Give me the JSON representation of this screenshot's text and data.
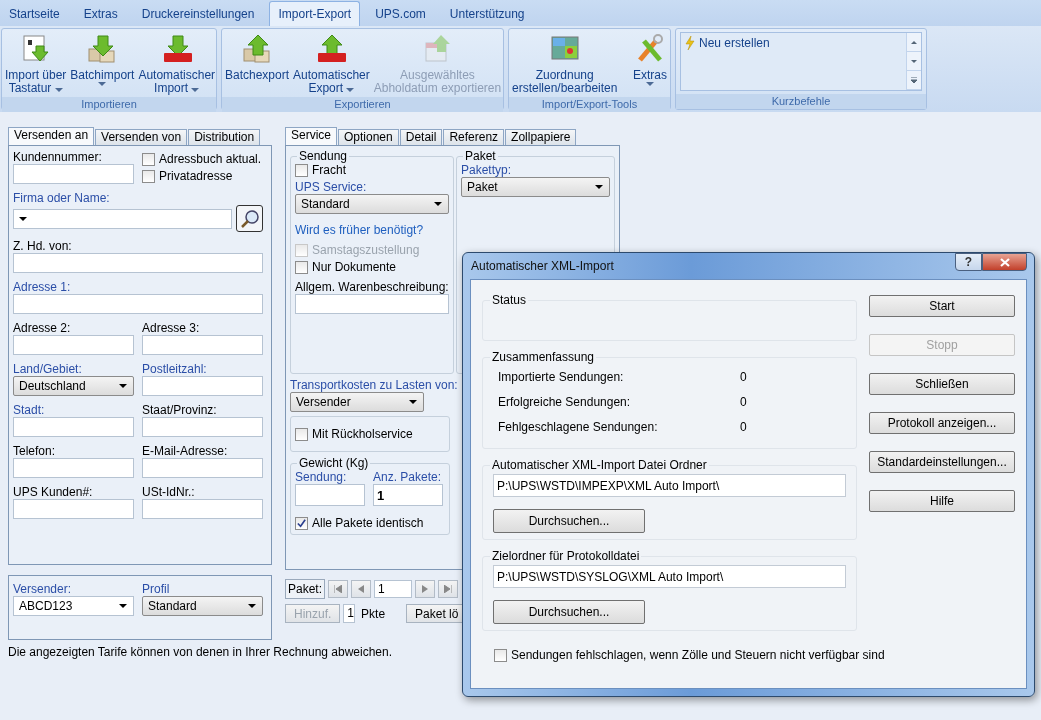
{
  "ribbon": {
    "tabs": [
      {
        "label": "Startseite",
        "selected": false
      },
      {
        "label": "Extras",
        "selected": false
      },
      {
        "label": "Druckereinstellungen",
        "selected": false
      },
      {
        "label": "Import-Export",
        "selected": true
      },
      {
        "label": "UPS.com",
        "selected": false
      },
      {
        "label": "Unterstützung",
        "selected": false
      }
    ],
    "groups": [
      {
        "label": "Importieren",
        "buttons": [
          {
            "kind": "keyboard-import",
            "lines": [
              "Import über",
              "Tastatur"
            ],
            "dropdown": true,
            "disabled": false
          },
          {
            "kind": "batch-import",
            "lines": [
              "Batchimport"
            ],
            "dropdown": true,
            "disabled": false
          },
          {
            "kind": "auto-import",
            "lines": [
              "Automatischer",
              "Import"
            ],
            "dropdown": true,
            "disabled": false
          }
        ]
      },
      {
        "label": "Exportieren",
        "buttons": [
          {
            "kind": "batch-export",
            "lines": [
              "Batchexport"
            ],
            "dropdown": false,
            "disabled": false
          },
          {
            "kind": "auto-export",
            "lines": [
              "Automatischer",
              "Export"
            ],
            "dropdown": true,
            "disabled": false
          },
          {
            "kind": "date-export",
            "lines": [
              "Ausgewähltes",
              "Abholdatum exportieren"
            ],
            "dropdown": false,
            "disabled": true
          }
        ]
      },
      {
        "label": "Import/Export-Tools",
        "buttons": [
          {
            "kind": "mapping",
            "lines": [
              "Zuordnung",
              "erstellen/bearbeiten"
            ],
            "dropdown": false,
            "disabled": false
          },
          {
            "kind": "tools",
            "lines": [
              "Extras"
            ],
            "dropdown": true,
            "disabled": false
          }
        ]
      }
    ],
    "shortcuts": {
      "label": "Kurzbefehle",
      "items": [
        "Neu erstellen"
      ]
    }
  },
  "ship_to": {
    "tabs": [
      {
        "label": "Versenden an",
        "selected": true
      },
      {
        "label": "Versenden von",
        "selected": false
      },
      {
        "label": "Distribution",
        "selected": false
      }
    ],
    "rows": [
      [
        {
          "kind": "text",
          "label": "Kundennummer:",
          "required": false
        },
        {
          "kind": "checks",
          "items": [
            {
              "label": "Adressbuch aktual.",
              "checked": false
            },
            {
              "label": "Privatadresse",
              "checked": false
            }
          ]
        }
      ],
      [
        {
          "kind": "combo-search",
          "label": "Firma oder Name:",
          "required": true
        }
      ],
      [
        {
          "kind": "text",
          "label": "Z. Hd. von:",
          "required": false
        }
      ],
      [
        {
          "kind": "text",
          "label": "Adresse 1:",
          "required": true
        }
      ],
      [
        {
          "kind": "text",
          "label": "Adresse 2:",
          "required": false
        },
        {
          "kind": "text",
          "label": "Adresse 3:",
          "required": false
        }
      ],
      [
        {
          "kind": "combo",
          "label": "Land/Gebiet:",
          "required": true,
          "value": "Deutschland"
        },
        {
          "kind": "text",
          "label": "Postleitzahl:",
          "required": true
        }
      ],
      [
        {
          "kind": "text",
          "label": "Stadt:",
          "required": true
        },
        {
          "kind": "text",
          "label": "Staat/Provinz:",
          "required": false
        }
      ],
      [
        {
          "kind": "text",
          "label": "Telefon:",
          "required": false
        },
        {
          "kind": "text",
          "label": "E-Mail-Adresse:",
          "required": false
        }
      ],
      [
        {
          "kind": "text",
          "label": "UPS Kunden#:",
          "required": false
        },
        {
          "kind": "text",
          "label": "USt-IdNr.:",
          "required": false
        }
      ]
    ]
  },
  "sender": {
    "fields": [
      {
        "kind": "combo-edit",
        "label": "Versender:",
        "required": true,
        "value": "ABCD123"
      },
      {
        "kind": "combo",
        "label": "Profil",
        "required": true,
        "value": "Standard"
      }
    ]
  },
  "note": "Die angezeigten Tarife können von denen in Ihrer Rechnung abweichen.",
  "service": {
    "tabs": [
      {
        "label": "Service",
        "selected": true
      },
      {
        "label": "Optionen",
        "selected": false
      },
      {
        "label": "Detail",
        "selected": false
      },
      {
        "label": "Referenz",
        "selected": false
      },
      {
        "label": "Zollpapiere",
        "selected": false
      }
    ],
    "shipment": {
      "title": "Sendung",
      "freight": {
        "label": "Fracht",
        "checked": false
      },
      "service_label": "UPS Service:",
      "service_value": "Standard",
      "link": "Wird es früher benötigt?",
      "saturday": {
        "label": "Samstagszustellung",
        "checked": false,
        "disabled": true
      },
      "documents": {
        "label": "Nur Dokumente",
        "checked": false
      },
      "description_label": "Allgem. Warenbeschreibung:"
    },
    "package": {
      "title": "Paket",
      "type_label": "Pakettyp:",
      "type_value": "Paket"
    },
    "transport_label": "Transportkosten zu Lasten von:",
    "transport_value": "Versender",
    "return_service": {
      "label": "Mit Rückholservice",
      "checked": false
    },
    "weight": {
      "title": "Gewicht (Kg)",
      "shipment_label": "Sendung:",
      "count_label": "Anz. Pakete:",
      "count_value": "1",
      "identical": {
        "label": "Alle Pakete identisch",
        "checked": true
      }
    },
    "navigator": {
      "label": "Paket:",
      "value": "1"
    },
    "add_button": {
      "label": "Hinzuf.",
      "disabled": true
    },
    "count": "1",
    "unit": "Pkte",
    "delete_button": {
      "label": "Paket lö"
    }
  },
  "dialog": {
    "title": "Automatischer XML-Import",
    "help_label": "?",
    "status_title": "Status",
    "summary_title": "Zusammenfassung",
    "summary": [
      {
        "label": "Importierte Sendungen:",
        "value": "0"
      },
      {
        "label": "Erfolgreiche Sendungen:",
        "value": "0"
      },
      {
        "label": "Fehlgeschlagene Sendungen:",
        "value": "0"
      }
    ],
    "folders": [
      {
        "title": "Automatischer XML-Import Datei Ordner",
        "path": "P:\\UPS\\WSTD\\IMPEXP\\XML Auto Import\\",
        "button": "Durchsuchen..."
      },
      {
        "title": "Zielordner für Protokolldatei",
        "path": "P:\\UPS\\WSTD\\SYSLOG\\XML Auto Import\\",
        "button": "Durchsuchen..."
      }
    ],
    "fail_option": {
      "label": "Sendungen fehlschlagen, wenn Zölle und Steuern nicht verfügbar sind",
      "checked": false
    },
    "buttons": [
      {
        "label": "Start",
        "disabled": false
      },
      {
        "label": "Stopp",
        "disabled": true
      },
      {
        "label": "Schließen",
        "disabled": false
      },
      {
        "label": "Protokoll anzeigen...",
        "disabled": false
      },
      {
        "label": "Standardeinstellungen...",
        "disabled": false
      },
      {
        "label": "Hilfe",
        "disabled": false
      }
    ]
  }
}
